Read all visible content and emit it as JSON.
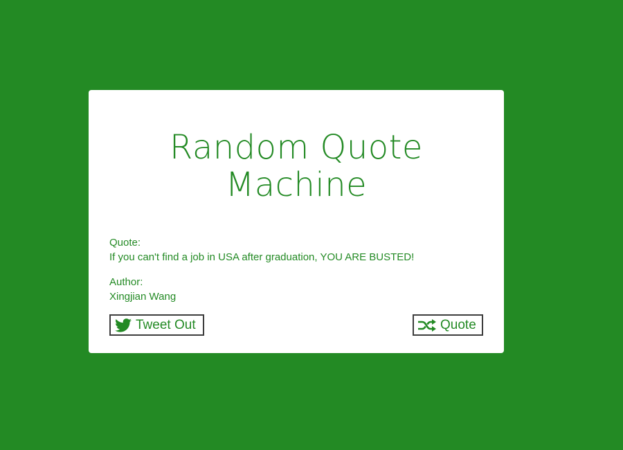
{
  "title": {
    "line1": "Random Quote",
    "line2": "Machine"
  },
  "quote": {
    "label": "Quote:",
    "text": "If you can't find a job in USA after graduation, YOU ARE BUSTED!"
  },
  "author": {
    "label": "Author:",
    "name": "Xingjian Wang"
  },
  "buttons": {
    "tweet_label": "Tweet Out",
    "tweet_icon": "twitter-icon",
    "quote_label": "Quote",
    "quote_icon": "shuffle-icon"
  },
  "colors": {
    "background": "#238a24",
    "card": "#ffffff",
    "accent": "#238a24",
    "button_border": "#3d3d3d"
  }
}
